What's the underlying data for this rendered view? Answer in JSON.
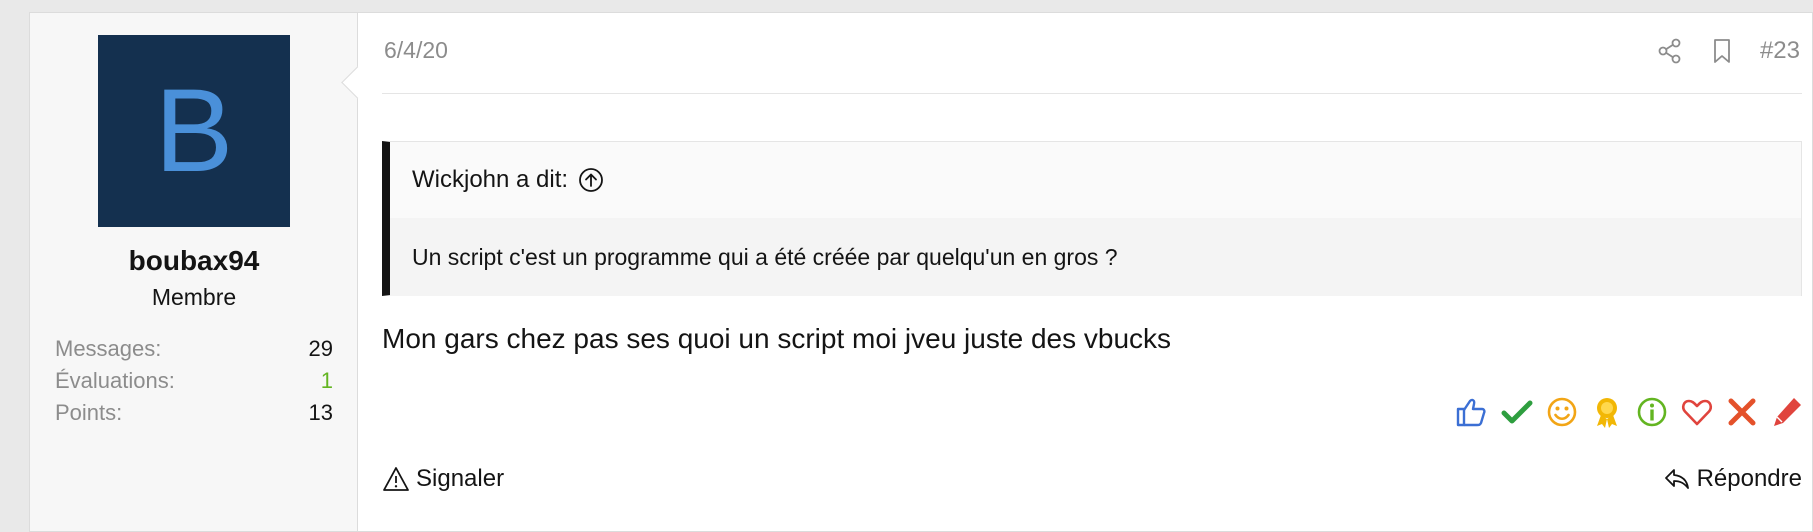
{
  "user": {
    "avatar_letter": "B",
    "avatar_bg": "#14304f",
    "avatar_fg": "#4a90d9",
    "username": "boubax94",
    "title": "Membre",
    "stats": [
      {
        "label": "Messages:",
        "value": "29"
      },
      {
        "label": "Évaluations:",
        "value": "1"
      },
      {
        "label": "Points:",
        "value": "13"
      }
    ]
  },
  "post": {
    "date": "6/4/20",
    "number": "#23",
    "share_icon": "share-icon",
    "bookmark_icon": "bookmark-icon"
  },
  "quote": {
    "author_label": "Wickjohn a dit:",
    "text": "Un script c'est un programme qui a été créée par quelqu'un en gros ?"
  },
  "message": {
    "text": "Mon gars chez pas ses quoi un script moi jveu juste des vbucks"
  },
  "reactions": [
    {
      "name": "like-reaction",
      "icon": "thumbs-up-icon",
      "color": "#3b6fd4"
    },
    {
      "name": "agree-reaction",
      "icon": "checkmark-icon",
      "color": "#2e9e3f"
    },
    {
      "name": "funny-reaction",
      "icon": "smiley-icon",
      "color": "#f2a516"
    },
    {
      "name": "award-reaction",
      "icon": "award-icon",
      "color": "#f2b705"
    },
    {
      "name": "info-reaction",
      "icon": "info-icon",
      "color": "#63b521"
    },
    {
      "name": "love-reaction",
      "icon": "heart-icon",
      "color": "#e0443d"
    },
    {
      "name": "disagree-reaction",
      "icon": "cross-icon",
      "color": "#e4512a"
    },
    {
      "name": "edit-reaction",
      "icon": "pencil-icon",
      "color": "#e0443d"
    }
  ],
  "actions": {
    "report_label": "Signaler",
    "reply_label": "Répondre"
  }
}
